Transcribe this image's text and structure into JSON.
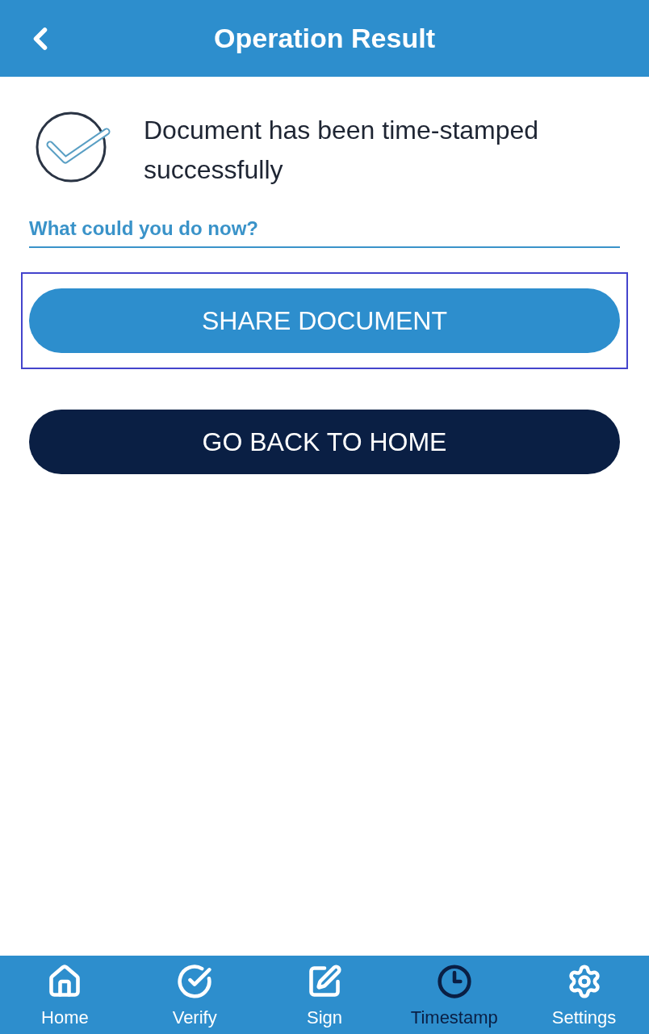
{
  "header": {
    "title": "Operation Result"
  },
  "result": {
    "message": "Document has been time-stamped successfully"
  },
  "section": {
    "title": "What could you do now?"
  },
  "actions": [
    {
      "label": "SHARE DOCUMENT",
      "kind": "primary",
      "focused": true
    },
    {
      "label": "GO BACK TO HOME",
      "kind": "secondary",
      "focused": false
    }
  ],
  "tabs": [
    {
      "label": "Home",
      "selected": false
    },
    {
      "label": "Verify",
      "selected": false
    },
    {
      "label": "Sign",
      "selected": false
    },
    {
      "label": "Timestamp",
      "selected": true
    },
    {
      "label": "Settings",
      "selected": false
    }
  ]
}
